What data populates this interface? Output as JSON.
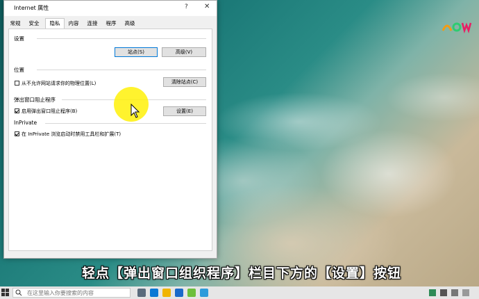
{
  "window": {
    "title": "Internet 属性",
    "help_label": "?",
    "close_label": "✕"
  },
  "tabs": [
    {
      "label": "常规",
      "active": false
    },
    {
      "label": "安全",
      "active": false
    },
    {
      "label": "隐私",
      "active": true
    },
    {
      "label": "内容",
      "active": false
    },
    {
      "label": "连接",
      "active": false
    },
    {
      "label": "程序",
      "active": false
    },
    {
      "label": "高级",
      "active": false
    }
  ],
  "settings": {
    "label": "设置",
    "sites_button": "站点(S)",
    "advanced_button": "高级(V)"
  },
  "location": {
    "label": "位置",
    "checkbox_label": "从不允许网站请求你的物理位置(L)",
    "checkbox_checked": false,
    "clear_sites_button": "清除站点(C)"
  },
  "popup_blocker": {
    "label": "弹出窗口阻止程序",
    "checkbox_label": "启用弹出窗口阻止程序(B)",
    "checkbox_checked": true,
    "settings_button": "设置(E)"
  },
  "inprivate": {
    "label": "InPrivate",
    "checkbox_label": "在 InPrivate 浏览启动时禁用工具栏和扩展(T)",
    "checkbox_checked": true
  },
  "caption": {
    "text": "轻点【弹出窗口组织程序】栏目下方的【设置】按钮"
  },
  "taskbar": {
    "search_placeholder": "在这里输入你要搜索的内容"
  },
  "colors": {
    "highlight": "#fff000",
    "dialog_bg": "#f0f0f0",
    "focus_border": "#0078d7"
  }
}
